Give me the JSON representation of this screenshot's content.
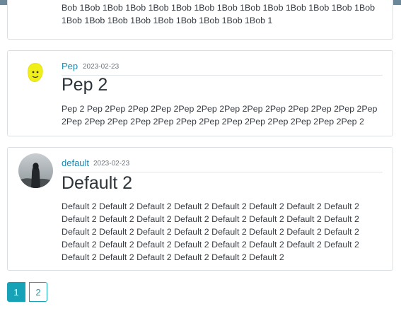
{
  "posts": [
    {
      "body": "Bob 1Bob 1Bob 1Bob 1Bob 1Bob 1Bob 1Bob 1Bob 1Bob 1Bob 1Bob 1Bob 1Bob 1Bob 1Bob 1Bob 1Bob 1Bob 1Bob 1Bob 1Bob 1Bob 1"
    },
    {
      "author": "Pep",
      "date": "2023-02-23",
      "title": "Pep 2",
      "body": "Pep 2 Pep 2Pep 2Pep 2Pep 2Pep 2Pep 2Pep 2Pep 2Pep 2Pep 2Pep 2Pep 2Pep 2Pep 2Pep 2Pep 2Pep 2Pep 2Pep 2Pep 2Pep 2Pep 2Pep 2Pep 2Pep 2Pep 2"
    },
    {
      "author": "default",
      "date": "2023-02-23",
      "title": "Default 2",
      "body": "Default 2 Default 2 Default 2 Default 2 Default 2 Default 2 Default 2 Default 2 Default 2 Default 2 Default 2 Default 2 Default 2 Default 2 Default 2 Default 2 Default 2 Default 2 Default 2 Default 2 Default 2 Default 2 Default 2 Default 2 Default 2 Default 2 Default 2 Default 2 Default 2 Default 2 Default 2 Default 2 Default 2 Default 2 Default 2 Default 2 Default 2 Default 2"
    }
  ],
  "pagination": {
    "pages": [
      "1",
      "2"
    ],
    "active": "1"
  },
  "colors": {
    "accent": "#17a2b8",
    "link": "#1a8ab0",
    "border": "#dcdfe2"
  }
}
